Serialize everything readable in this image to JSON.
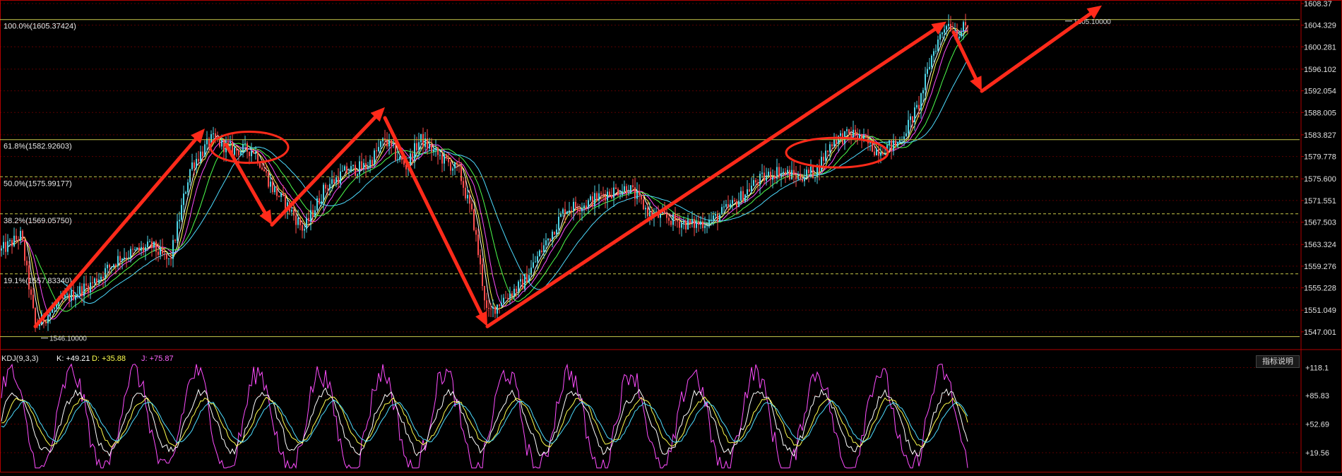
{
  "colors": {
    "background": "#000000",
    "up_candle": "#4fd6e8",
    "down_candle": "#ff4d4d",
    "grid": "#5a0000",
    "axis": "#b00000",
    "fib_solid": "#c8c84b",
    "fib_dashed": "#c8c84b",
    "arrow": "#ff2a1a",
    "ma1": "#ffffff",
    "ma2": "#ffff4f",
    "ma3": "#ff4dff",
    "ma4": "#4dff4d",
    "ma5": "#4ddcff",
    "kdj_k": "#ffffff",
    "kdj_d": "#ffff4f",
    "kdj_j": "#ff4dff",
    "kdj_extra": "#4ddcff"
  },
  "price_axis": {
    "ticks": [
      "1608.37",
      "1604.329",
      "1600.281",
      "1596.102",
      "1592.054",
      "1588.005",
      "1583.827",
      "1579.778",
      "1575.600",
      "1571.551",
      "1567.503",
      "1563.324",
      "1559.276",
      "1555.228",
      "1551.049",
      "1547.001"
    ],
    "tick_values": [
      1608.37,
      1604.329,
      1600.281,
      1596.102,
      1592.054,
      1588.005,
      1583.827,
      1579.778,
      1575.6,
      1571.551,
      1567.503,
      1563.324,
      1559.276,
      1555.228,
      1551.049,
      1547.001
    ]
  },
  "fibonacci": [
    {
      "label": "100.0%(1605.37424)",
      "value": 1605.37424,
      "style": "solid"
    },
    {
      "label": "61.8%(1582.92603)",
      "value": 1582.92603,
      "style": "solid"
    },
    {
      "label": "50.0%(1575.99177)",
      "value": 1575.99177,
      "style": "dashed"
    },
    {
      "label": "38.2%(1569.05750)",
      "value": 1569.0575,
      "style": "dashed"
    },
    {
      "label": "19.1%(1557.83340)",
      "value": 1557.8334,
      "style": "dashed"
    },
    {
      "label": "",
      "value": 1546.1,
      "style": "solid"
    }
  ],
  "annotations": {
    "high_label": "1605.10000",
    "low_label": "1546.10000"
  },
  "kdj": {
    "title": "KDJ(9,3,3)",
    "k_label": "K: +49.21",
    "d_label": "D: +35.88",
    "j_label": "J: +75.87",
    "axis_ticks": [
      "+118.1",
      "+85.83",
      "+52.69",
      "+19.56"
    ],
    "axis_values": [
      118.1,
      85.83,
      52.69,
      19.56
    ]
  },
  "indicator_button_label": "指标说明",
  "chart_data": {
    "type": "candlestick",
    "ylim": [
      1545.0,
      1608.37
    ],
    "price_path": [
      [
        0,
        1562
      ],
      [
        30,
        1565
      ],
      [
        50,
        1548
      ],
      [
        90,
        1553
      ],
      [
        130,
        1556
      ],
      [
        170,
        1561
      ],
      [
        215,
        1563
      ],
      [
        240,
        1560
      ],
      [
        270,
        1578
      ],
      [
        300,
        1583
      ],
      [
        330,
        1581
      ],
      [
        360,
        1581
      ],
      [
        385,
        1574
      ],
      [
        410,
        1570
      ],
      [
        430,
        1566
      ],
      [
        460,
        1574
      ],
      [
        490,
        1577
      ],
      [
        520,
        1578
      ],
      [
        545,
        1583
      ],
      [
        560,
        1580
      ],
      [
        575,
        1578
      ],
      [
        595,
        1583
      ],
      [
        620,
        1580
      ],
      [
        650,
        1577
      ],
      [
        670,
        1568
      ],
      [
        690,
        1550
      ],
      [
        710,
        1553
      ],
      [
        740,
        1556
      ],
      [
        770,
        1563
      ],
      [
        800,
        1570
      ],
      [
        830,
        1571
      ],
      [
        860,
        1573
      ],
      [
        890,
        1574
      ],
      [
        920,
        1569
      ],
      [
        950,
        1568
      ],
      [
        980,
        1567
      ],
      [
        1010,
        1568
      ],
      [
        1040,
        1571
      ],
      [
        1070,
        1575
      ],
      [
        1100,
        1577
      ],
      [
        1130,
        1576
      ],
      [
        1155,
        1577
      ],
      [
        1180,
        1583
      ],
      [
        1210,
        1584
      ],
      [
        1240,
        1581
      ],
      [
        1270,
        1582
      ],
      [
        1300,
        1589
      ],
      [
        1320,
        1599
      ],
      [
        1340,
        1605
      ],
      [
        1355,
        1603
      ],
      [
        1370,
        1604
      ]
    ],
    "arrows": [
      {
        "from": [
          50,
          1548
        ],
        "to": [
          290,
          1585
        ]
      },
      {
        "from": [
          320,
          1582
        ],
        "to": [
          385,
          1567
        ]
      },
      {
        "from": [
          385,
          1567
        ],
        "to": [
          545,
          1589
        ]
      },
      {
        "from": [
          545,
          1587
        ],
        "to": [
          690,
          1548
        ]
      },
      {
        "from": [
          690,
          1548
        ],
        "to": [
          1340,
          1605
        ]
      },
      {
        "from": [
          1350,
          1603
        ],
        "to": [
          1390,
          1592
        ]
      },
      {
        "from": [
          1390,
          1592
        ],
        "to": [
          1560,
          1608
        ]
      }
    ],
    "circles": [
      {
        "cx": 353,
        "cy": 1581.5
      },
      {
        "cx": 1185,
        "cy": 1580.5
      }
    ]
  }
}
